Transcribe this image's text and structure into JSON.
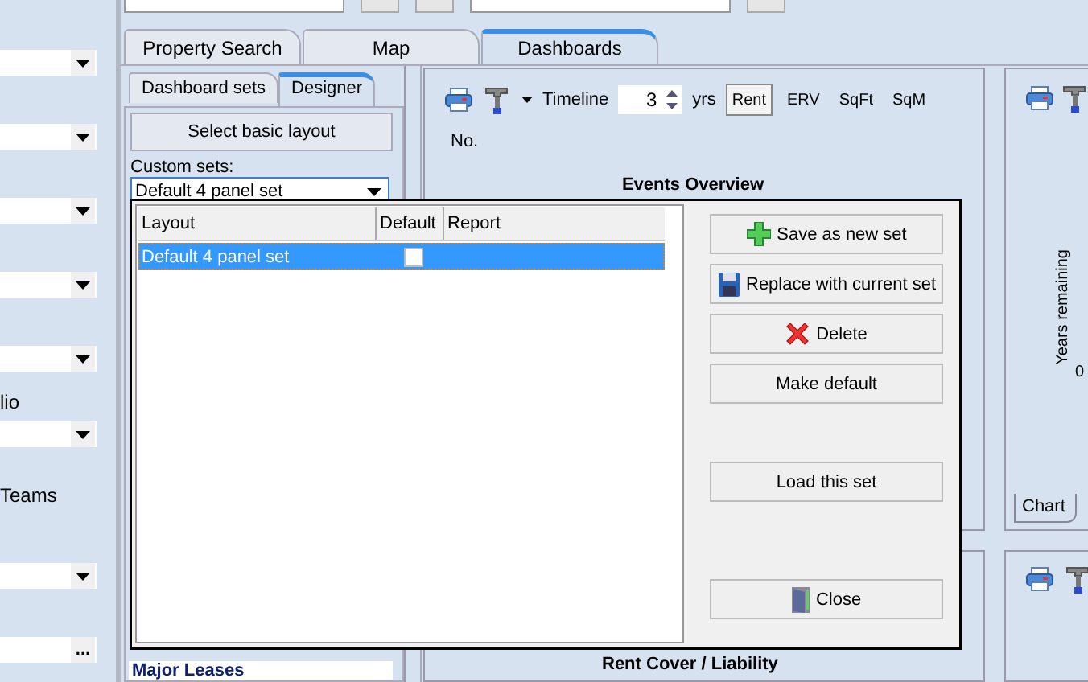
{
  "sidebar": {
    "items": [
      {
        "kind": "combo"
      },
      {
        "kind": "combo"
      },
      {
        "kind": "combo"
      },
      {
        "kind": "combo"
      },
      {
        "kind": "combo"
      },
      {
        "kind": "label",
        "text": "lio"
      },
      {
        "kind": "combo"
      },
      {
        "kind": "label",
        "text": "Teams"
      },
      {
        "kind": "combo"
      },
      {
        "kind": "browse",
        "button": "..."
      }
    ]
  },
  "tabs": [
    {
      "label": "Property Search",
      "selected": false
    },
    {
      "label": "Map",
      "selected": false
    },
    {
      "label": "Dashboards",
      "selected": true
    }
  ],
  "designer": {
    "tabs": [
      {
        "label": "Dashboard sets",
        "selected": false
      },
      {
        "label": "Designer",
        "selected": true
      }
    ],
    "select_button": "Select basic layout",
    "custom_sets_label": "Custom sets:",
    "custom_sets_value": "Default 4 panel set",
    "section_title": "Major Leases"
  },
  "events_panel": {
    "timeline_label": "Timeline",
    "timeline_value": "3",
    "units": "yrs",
    "measures": [
      {
        "label": "Rent",
        "selected": true
      },
      {
        "label": "ERV",
        "selected": false
      },
      {
        "label": "SqFt",
        "selected": false
      },
      {
        "label": "SqM",
        "selected": false
      }
    ],
    "column_label": "No.",
    "title": "Events Overview"
  },
  "years_panel": {
    "axis_label": "Years remaining",
    "tick": "0",
    "tab": "Chart"
  },
  "rent_panel": {
    "title": "Rent Cover / Liability"
  },
  "dialog": {
    "columns": [
      "Layout",
      "Default",
      "Report"
    ],
    "rows": [
      {
        "layout": "Default 4 panel set",
        "default": false,
        "selected": true
      }
    ],
    "buttons": [
      {
        "label": "Save as new set",
        "kind": "add"
      },
      {
        "label": "Replace with current set",
        "kind": "save"
      },
      {
        "label": "Delete",
        "kind": "delete"
      },
      {
        "label": "Make default",
        "kind": "plain"
      },
      {
        "label": "Load this set",
        "kind": "plain"
      },
      {
        "label": "Close",
        "kind": "close"
      }
    ]
  }
}
